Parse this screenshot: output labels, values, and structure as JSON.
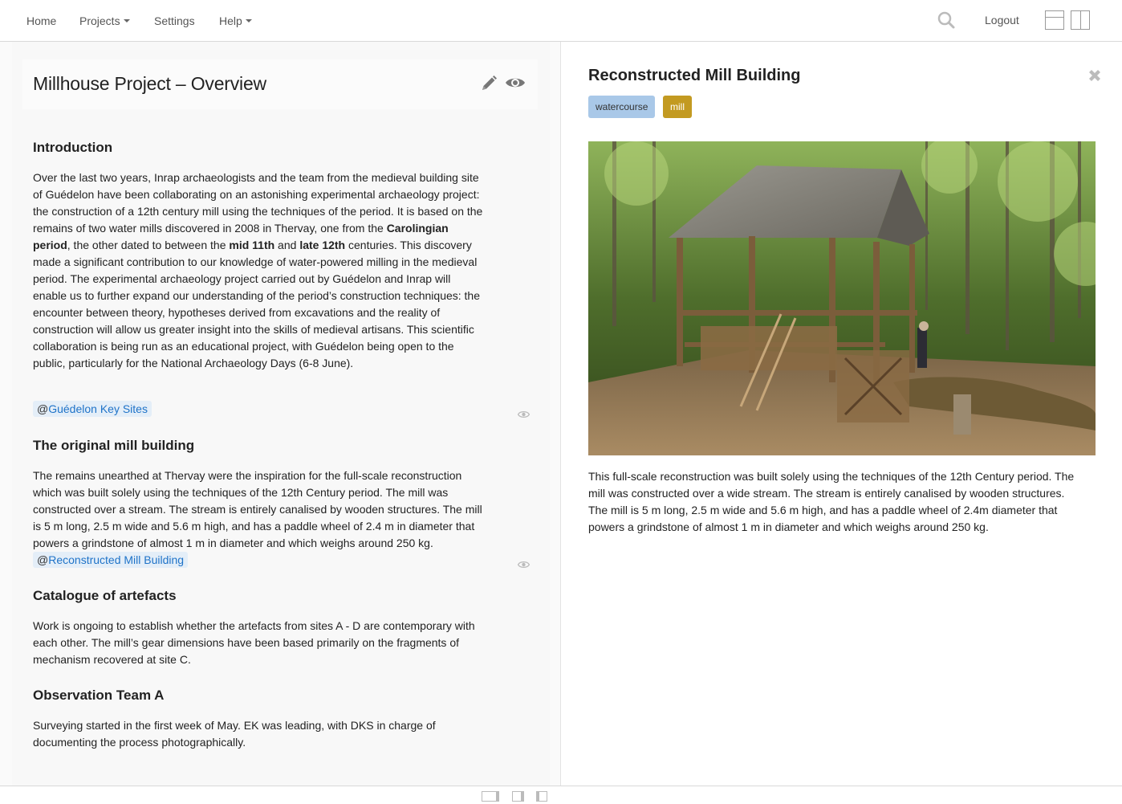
{
  "nav": {
    "home": "Home",
    "projects": "Projects",
    "settings": "Settings",
    "help": "Help",
    "logout": "Logout"
  },
  "document": {
    "title": "Millhouse Project – Overview",
    "sections": [
      {
        "heading": "Introduction",
        "body_parts": {
          "p1": "Over the last two years, Inrap archaeologists and the team from the medieval building site of Guédelon have been collaborating on an astonishing experimental archaeology project: the construction of a 12th century mill using the techniques of the period. It is based on the remains of two water mills discovered in 2008 in Thervay, one from the ",
          "b1": "Carolingian period",
          "p2": ", the other dated to between the ",
          "b2": "mid 11th",
          "p3": " and ",
          "b3": "late 12th",
          "p4": " centuries. This discovery made a significant contribution to our knowledge of water-powered milling in the medieval period. The experimental archaeology project carried out by Guédelon and Inrap will enable us to further expand our understanding of the period’s construction techniques: the encounter between theory, hypotheses derived from excavations and the reality of construction will allow us greater insight into the skills of medieval artisans. This scientific collaboration is being run as an educational project, with Guédelon being open to the public, particularly for the National Archaeology Days (6-8 June)."
        },
        "ref_at": "@",
        "ref_label": "Guédelon Key Sites"
      },
      {
        "heading": "The original mill building",
        "body": "The remains unearthed at Thervay were the inspiration for the full-scale reconstruction which was built solely using the techniques of the 12th Century period. The mill was constructed over a stream. The stream is entirely canalised by wooden structures. The mill is 5 m long, 2.5 m wide and 5.6 m high, and has a paddle wheel of 2.4 m in diameter that powers a grindstone of almost 1 m in diameter and which weighs around 250 kg.",
        "ref_at": "@",
        "ref_label": "Reconstructed Mill Building"
      },
      {
        "heading": "Catalogue of artefacts",
        "body": "Work is ongoing to establish whether the artefacts from sites A - D are contemporary with each other. The mill’s gear dimensions have been based primarily on the fragments of mechanism recovered at site C."
      },
      {
        "heading": "Observation Team A",
        "body": "Surveying started in the first week of May. EK was leading, with DKS in charge of documenting the process photographically."
      }
    ]
  },
  "detail": {
    "title": "Reconstructed Mill Building",
    "tags": [
      "watercourse",
      "mill"
    ],
    "description": "This full-scale reconstruction was built solely using the techniques of the 12th Century period. The mill was constructed over a wide stream. The stream is entirely canalised by wooden structures. The mill is 5 m long, 2.5 m wide and 5.6 m high, and has a paddle wheel of 2.4m diameter that powers a grindstone of almost 1 m in diameter and which weighs around 250 kg."
  },
  "colors": {
    "link": "#1f73c8",
    "tag_watercourse": "#a9c8e8",
    "tag_mill": "#c39a21",
    "ref_bg": "#e4eef8"
  },
  "icons": [
    "search-icon",
    "pencil-icon",
    "eye-icon",
    "close-icon",
    "layout-horizontal-icon",
    "layout-vertical-icon"
  ]
}
